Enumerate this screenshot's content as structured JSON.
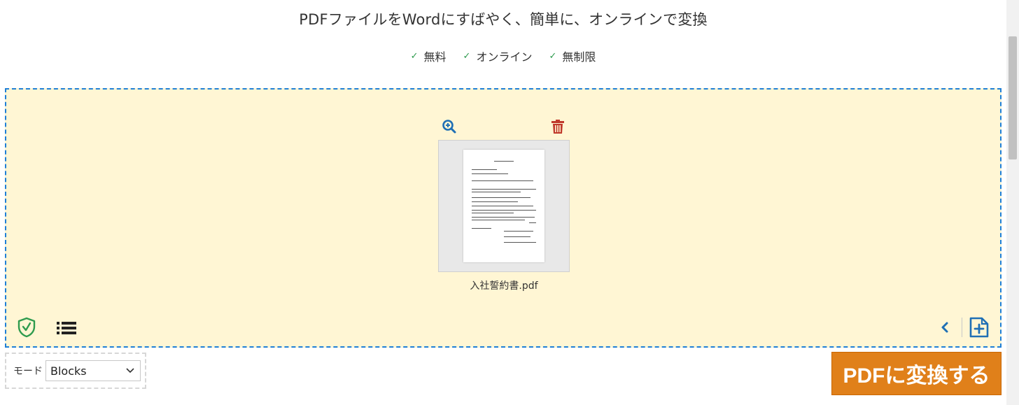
{
  "header": {
    "headline": "PDFファイルをWordにすばやく、簡単に、オンラインで変換",
    "features": [
      {
        "check": "✓",
        "label": "無料"
      },
      {
        "check": "✓",
        "label": "オンライン"
      },
      {
        "check": "✓",
        "label": "無制限"
      }
    ]
  },
  "dropzone": {
    "file": {
      "name": "入社誓約書.pdf"
    },
    "icons": {
      "zoom": "zoom-in-icon",
      "delete": "trash-icon",
      "security": "shield-check-icon",
      "list": "list-icon",
      "prev": "chevron-left-icon",
      "add": "add-file-icon"
    }
  },
  "options": {
    "mode_label": "モード",
    "mode_value": "Blocks"
  },
  "actions": {
    "convert_label": "PDFに変換する"
  },
  "colors": {
    "dropzone_bg": "#fff6d4",
    "dropzone_border": "#1f7fd6",
    "convert_bg": "#e0801a",
    "check": "#2e9b4e",
    "delete": "#c0392b",
    "icon_blue": "#1f6fb5",
    "shield": "#2e9b4e"
  }
}
